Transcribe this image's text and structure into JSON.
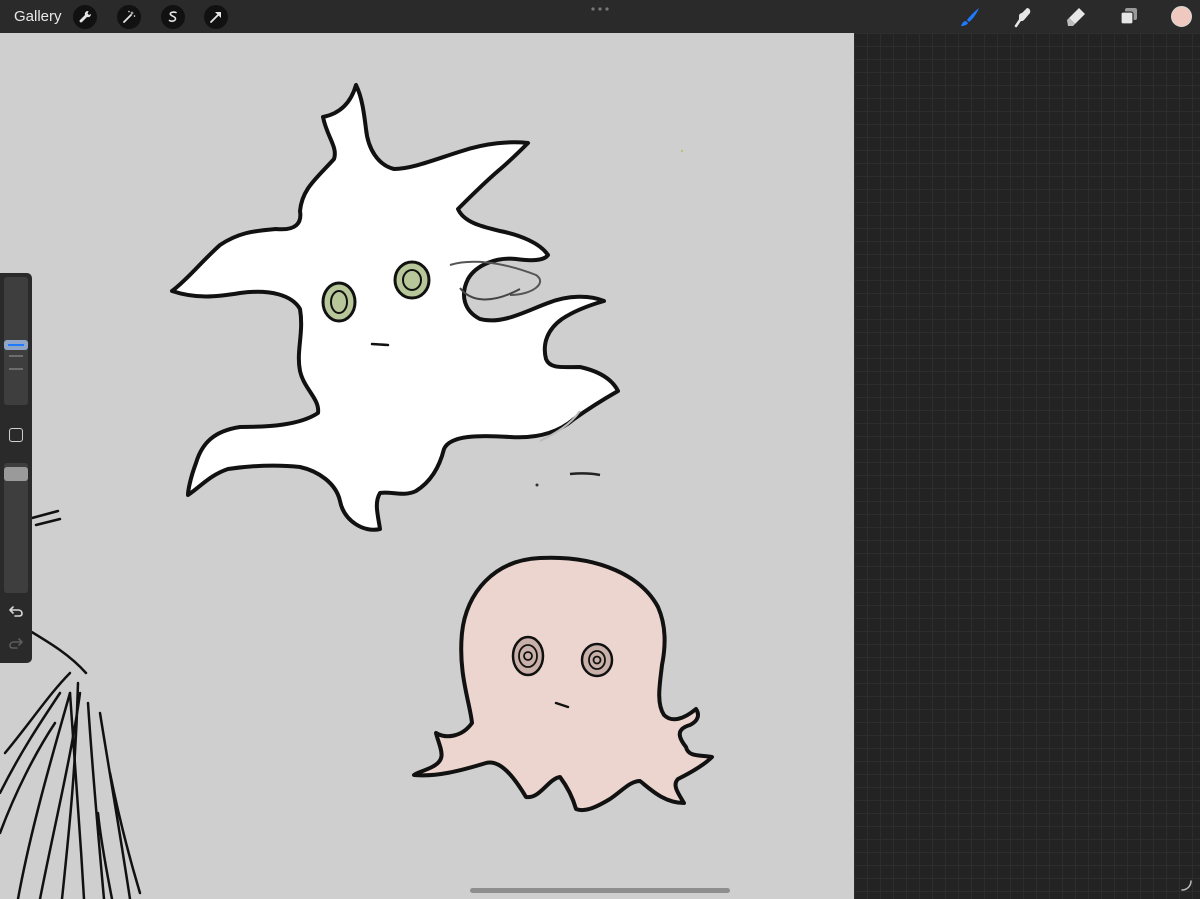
{
  "topbar": {
    "gallery_label": "Gallery",
    "left_tools": [
      "wrench-icon",
      "magic-wand-icon",
      "selection-icon",
      "transform-arrow-icon"
    ],
    "right_tools": [
      "brush-icon",
      "smudge-icon",
      "eraser-icon",
      "layers-icon"
    ],
    "active_tool": "brush-icon"
  },
  "colors": {
    "active_color": "#efc9bf",
    "canvas_background": "#cfcfcf",
    "ghost_fill": "#ffffff",
    "octopus_fill": "#ecd5cf",
    "ghost_eye": "#b8c79a",
    "accent": "#1e7bff"
  },
  "sidebar": {
    "brush_size": 0.5,
    "opacity": 1.0,
    "controls": [
      "brush-size-slider",
      "modify-button",
      "opacity-slider",
      "undo-icon",
      "redo-icon"
    ]
  }
}
